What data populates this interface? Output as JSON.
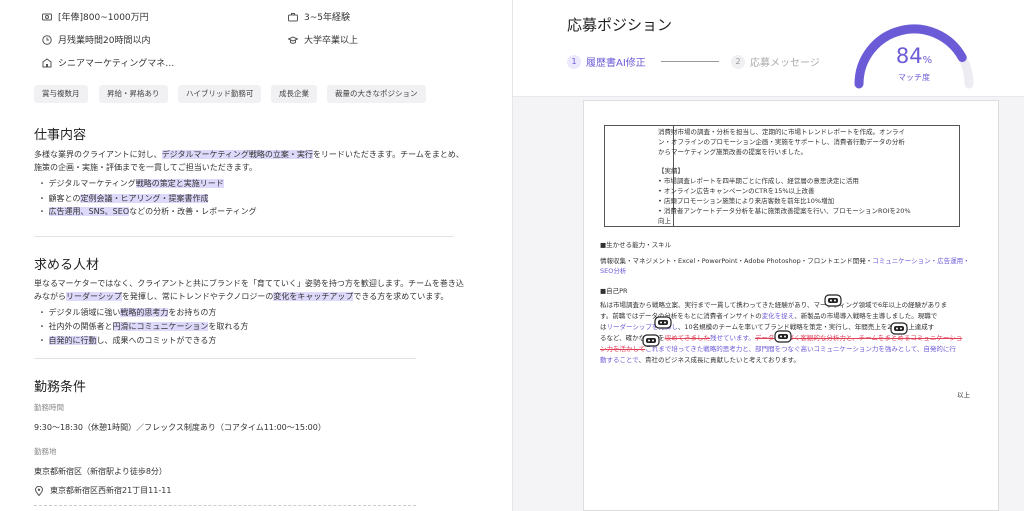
{
  "job": {
    "salary": "[年俸]800~1000万円",
    "experience": "3~5年経験",
    "overtime": "月残業時間20時間以内",
    "education": "大学卒業以上",
    "position": "シニアマーケティングマネ…",
    "tags": [
      "賞与複数月",
      "昇給・昇格あり",
      "ハイブリッド勤務可",
      "成長企業",
      "裁量の大きなポジション"
    ],
    "duties": {
      "title": "仕事内容",
      "intro_a": "多様な業界のクライアントに対し、",
      "intro_hl": "デジタルマーケティング戦略の立案・実行",
      "intro_b": "をリードいただきます。チームをまとめ、",
      "intro_line2": "施策の企画・実施・評価までを一貫してご担当いただきます。",
      "b1_a": "・ デジタルマーケティング",
      "b1_hl": "戦略の策定と実施リード",
      "b2_a": "・ 顧客との",
      "b2_hl": "定例会議・ヒアリング・提案書作成",
      "b3_a": "・ ",
      "b3_hl": "広告運用、SNS、SEO",
      "b3_b": "などの分析・改善・レポーティング"
    },
    "requirements": {
      "title": "求める人材",
      "line1": "単なるマーケターではなく、クライアントと共にブランドを「育てていく」姿勢を持つ方を歓迎します。チームを巻き込",
      "line2_a": "みながら",
      "line2_hl1": "リーダーシップ",
      "line2_b": "を発揮し、常にトレンドやテクノロジーの",
      "line2_hl2": "変化をキャッチアップ",
      "line2_c": "できる方を求めています。",
      "b1_a": "・ デジタル領域に強い",
      "b1_hl": "戦略的思考力",
      "b1_b": "をお持ちの方",
      "b2_a": "・ 社内外の関係者と",
      "b2_hl": "円滑にコミュニケーション",
      "b2_b": "を取れる方",
      "b3_a": "・ ",
      "b3_hl": "自発的に行動",
      "b3_b": "し、成果へのコミットができる方"
    },
    "conditions": {
      "title": "勤務条件",
      "hours_label": "勤務時間",
      "hours": "9:30〜18:30（休憩1時間）／フレックス制度あり（コアタイム11:00〜15:00）",
      "location_label": "勤務地",
      "location": "東京都新宿区（新宿駅より徒歩8分）",
      "address": "東京都新宿区西新宿21丁目11-11"
    }
  },
  "application": {
    "title": "応募ポジション",
    "step1_num": "1",
    "step1": "履歴書AI修正",
    "step2_num": "2",
    "step2": "応募メッセージ",
    "match_value": 84,
    "match_number": "84",
    "match_unit": "%",
    "match_label": "マッチ度",
    "accent": "#6b5bd6"
  },
  "resume": {
    "table_lines": [
      "消費財市場の調査・分析を担当し、定期的に市場トレンドレポートを作成。オンライ",
      "ン・オフラインのプロモーション企画・実施をサポートし、消費者行動データの分析",
      "からマーケティング施策改善の提案を行いました。"
    ],
    "results_label": "【実績】",
    "results": [
      "• 市場調査レポートを四半期ごとに作成し、経営層の意思決定に活用",
      "• オンライン広告キャンペーンのCTRを15%以上改善",
      "• 店頭プロモーション施策により来店客数を前年比10%増加",
      "• 消費者アンケートデータ分析を基に施策改善提案を行い、プロモーションROIを20%",
      "向上"
    ],
    "skills_title": "■生かせる能力・スキル",
    "skills_a": "情報収集・マネジメント・Excel・PowerPoint・Adobe Photoshop・フロントエンド開発・",
    "skills_hl": "コミュニケーション・広告運用・",
    "skills_hl2": "SEO分析",
    "pr_title": "■自己PR",
    "pr1": "私は市場調査から戦略立案、実行まで一貫して携わってきた経験があり、マーケティング領域で6年以上の経験がありま",
    "pr2_a": "す。前職ではデータの分析をもとに消費者インサイトの",
    "pr2_hl": "変化を捉え",
    "pr2_b": "、新製品の市場導入戦略を主導しました。現職で",
    "pr3_a": "は",
    "pr3_hl": "リーダーシップを発揮し",
    "pr3_b": "、10名規模のチームを率いてブランド戦略を策定・実行し、年間売上を20%以上達成す",
    "pr4_a": "るなど、確かな成果を",
    "pr4_red": "収めてきました",
    "pr4_hl": "残せています。",
    "pr4_red2": "データに基づく客観的な分析力と、チームをまとめるコミュニケーショ",
    "pr5_red": "ン力を活かして",
    "pr5_hl": "これまで培ってきた戦略的思考力と、部門間をつなぐ高いコミュニケーション力を強みとして、自発的に行",
    "pr6_hl": "動することで",
    "pr6_b": "、貴社のビジネス成長に貢献したいと考えております。",
    "end": "以上"
  }
}
